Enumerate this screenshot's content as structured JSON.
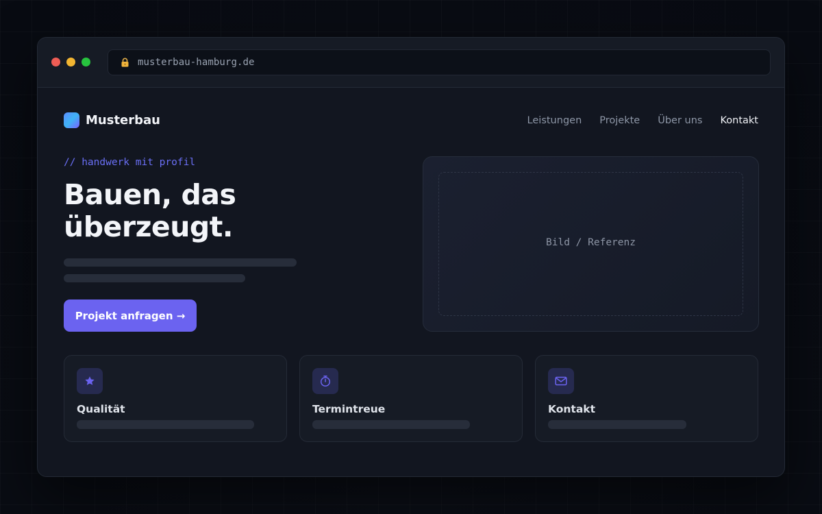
{
  "browser": {
    "url": "musterbau-hamburg.de",
    "icons": {
      "lock": "lock-icon"
    }
  },
  "site": {
    "brand": "Musterbau",
    "nav": [
      {
        "label": "Leistungen",
        "active": false
      },
      {
        "label": "Projekte",
        "active": false
      },
      {
        "label": "Über uns",
        "active": false
      },
      {
        "label": "Kontakt",
        "active": true
      }
    ]
  },
  "hero": {
    "tagline": "// handwerk mit profil",
    "headline_line1": "Bauen, das",
    "headline_line2": "überzeugt.",
    "cta_label": "Projekt anfragen →",
    "media_label": "Bild / Referenz"
  },
  "features": [
    {
      "title": "Qualität",
      "icon": "star-icon"
    },
    {
      "title": "Termintreue",
      "icon": "stopwatch-icon"
    },
    {
      "title": "Kontakt",
      "icon": "envelope-icon"
    }
  ],
  "colors": {
    "accent": "#6b63f0",
    "background": "#121620",
    "text": "#f3f5f9",
    "muted": "#8e97a7"
  }
}
